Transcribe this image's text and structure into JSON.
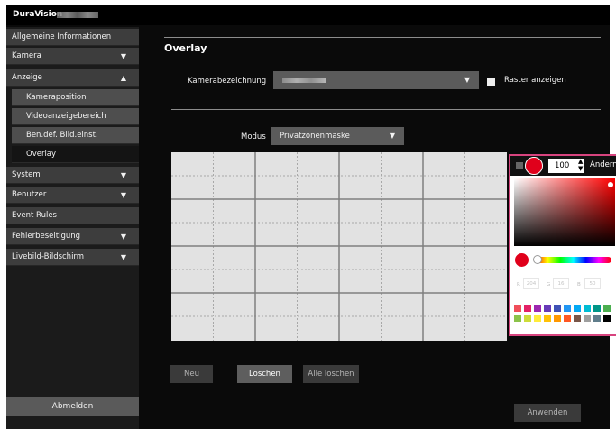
{
  "app": {
    "brand": "DuraVision"
  },
  "sidebar": {
    "items": [
      {
        "label": "Allgemeine Informationen",
        "arrow": ""
      },
      {
        "label": "Kamera",
        "arrow": "▼"
      },
      {
        "label": "Anzeige",
        "arrow": "▲"
      },
      {
        "label": "System",
        "arrow": "▼"
      },
      {
        "label": "Benutzer",
        "arrow": "▼"
      },
      {
        "label": "Event Rules",
        "arrow": ""
      },
      {
        "label": "Fehlerbeseitigung",
        "arrow": "▼"
      },
      {
        "label": "Livebild-Bildschirm",
        "arrow": "▼"
      }
    ],
    "subitems": [
      {
        "label": "Kameraposition"
      },
      {
        "label": "Videoanzeigebereich"
      },
      {
        "label": "Ben.def. Bild.einst."
      },
      {
        "label": "Overlay"
      }
    ],
    "logout_label": "Abmelden"
  },
  "main": {
    "title": "Overlay",
    "camera_label": "Kamerabezeichnung",
    "grid_checkbox_label": "Raster anzeigen",
    "mode_label": "Modus",
    "mode_value": "Privatzonenmaske",
    "dropdown_icon": "▼",
    "buttons": {
      "new": "Neu",
      "delete": "Löschen",
      "delete_all": "Alle löschen",
      "apply": "Anwenden"
    }
  },
  "picker": {
    "opacity_value": "100",
    "change_label": "Ändern",
    "r_label": "R",
    "r_value": "204",
    "g_label": "G",
    "g_value": "16",
    "b_label": "B",
    "b_value": "50",
    "current_color": "#e0001b",
    "swatches": [
      "#f04e5a",
      "#e32166",
      "#9c27b0",
      "#673ab7",
      "#3f51b5",
      "#2196f3",
      "#03a9f4",
      "#00bcd4",
      "#009688",
      "#4caf50",
      "#8bc34a",
      "#cddc39",
      "#ffeb3b",
      "#ffc107",
      "#ff9800",
      "#ff5722",
      "#795548",
      "#9e9e9e",
      "#607d8b",
      "#000000"
    ]
  },
  "colors": {
    "accent_border": "#d8447f",
    "sidebar_item": "#3d3d3d",
    "sidebar_sub": "#4e4e4e",
    "sidebar_active": "#141414"
  }
}
